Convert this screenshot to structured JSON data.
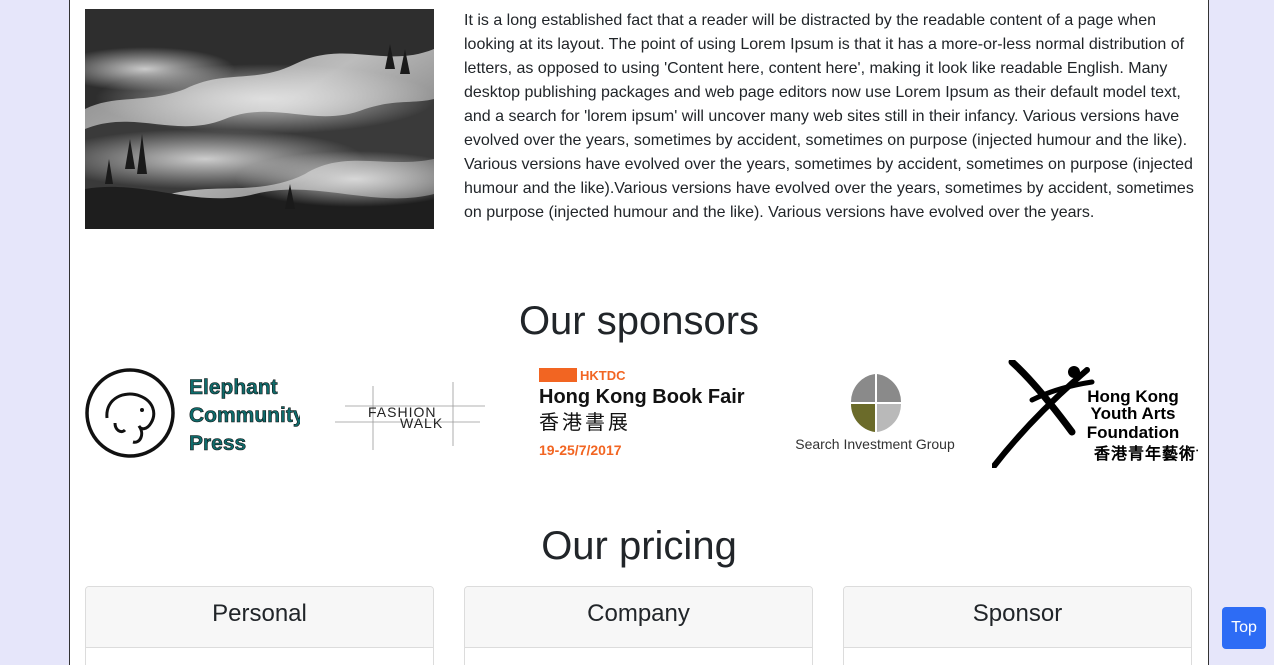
{
  "about": {
    "image_alt": "Misty forest mountains in black and white",
    "text": "It is a long established fact that a reader will be distracted by the readable content of a page when looking at its layout. The point of using Lorem Ipsum is that it has a more-or-less normal distribution of letters, as opposed to using 'Content here, content here', making it look like readable English. Many desktop publishing packages and web page editors now use Lorem Ipsum as their default model text, and a search for 'lorem ipsum' will uncover many web sites still in their infancy. Various versions have evolved over the years, sometimes by accident, sometimes on purpose (injected humour and the like). Various versions have evolved over the years, sometimes by accident, sometimes on purpose (injected humour and the like).Various versions have evolved over the years, sometimes by accident, sometimes on purpose (injected humour and the like). Various versions have evolved over the years."
  },
  "sponsors": {
    "title": "Our sponsors",
    "items": [
      {
        "name": "Elephant Community Press",
        "lines": [
          "Elephant",
          "Community",
          "Press"
        ],
        "color": "#0f6b6b"
      },
      {
        "name": "Fashion Walk",
        "lines": [
          "FASHION",
          "WALK"
        ]
      },
      {
        "name": "Hong Kong Book Fair",
        "tag": "HKTDC",
        "title": "Hong Kong Book Fair",
        "chinese": "香港書展",
        "dates": "19-25/7/2017",
        "accent": "#f26522"
      },
      {
        "name": "Search Investment Group",
        "caption": "Search Investment Group",
        "colors": [
          "#6b6b2a",
          "#8a8a8a"
        ]
      },
      {
        "name": "Hong Kong Youth Arts Foundation",
        "lines": [
          "Hong Kong",
          "Youth Arts",
          "Foundation"
        ],
        "chinese": "香港青年藝術協會"
      }
    ]
  },
  "pricing": {
    "title": "Our pricing",
    "plans": [
      {
        "name": "Personal"
      },
      {
        "name": "Company"
      },
      {
        "name": "Sponsor"
      }
    ]
  },
  "top_button": {
    "label": "Top"
  },
  "colors": {
    "page_bg": "#e6e6fa",
    "button": "#2d6cf5"
  }
}
